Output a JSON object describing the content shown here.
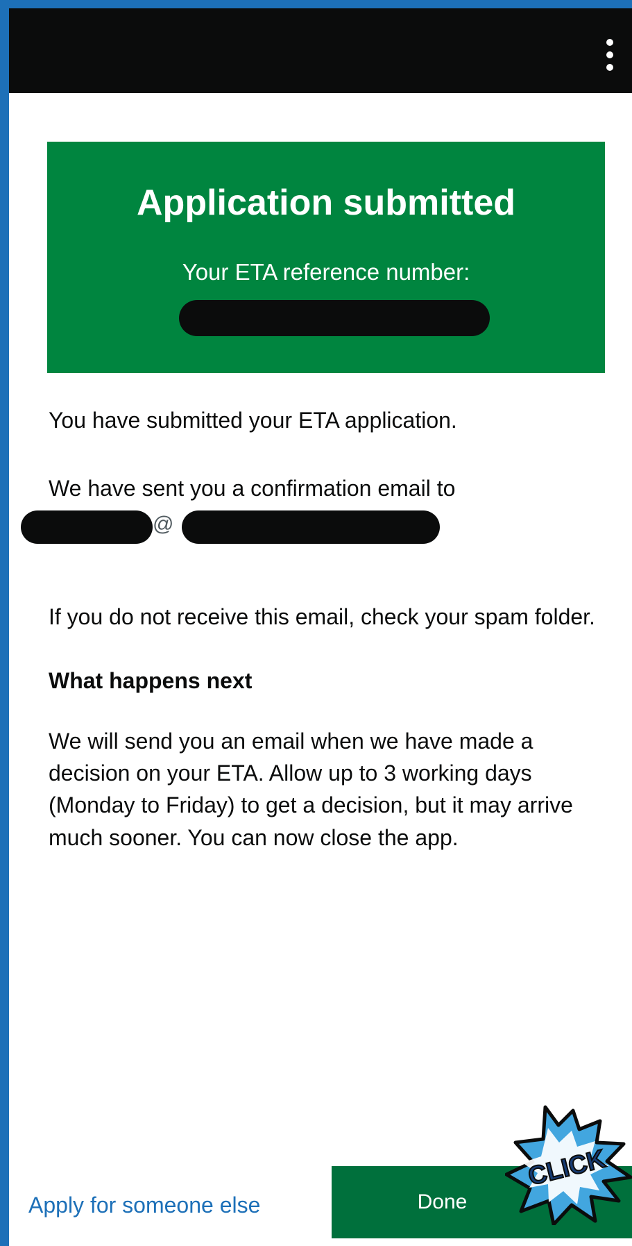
{
  "screen": {
    "menu_icon": "vertical-ellipsis-icon"
  },
  "panel": {
    "title": "Application submitted",
    "reference_label": "Your ETA reference number:"
  },
  "content": {
    "submitted_text": "You have submitted your ETA application.",
    "email_intro": "We have sent you a confirmation email to",
    "email_at": "@",
    "spam_text": "If you do not receive this email, check your spam folder.",
    "next_heading": "What happens next",
    "decision_text": "We will send you an email when we have made a decision on your ETA. Allow up to 3 working days (Monday to Friday) to get a decision, but it may arrive much sooner. You can now close the app."
  },
  "actions": {
    "apply_link": "Apply for someone else",
    "done_button": "Done"
  },
  "overlay": {
    "burst_text": "CLICK"
  },
  "colors": {
    "success": "#00853f",
    "link": "#1d70b8",
    "text": "#0b0c0c",
    "top_bar": "#0b0c0c"
  }
}
